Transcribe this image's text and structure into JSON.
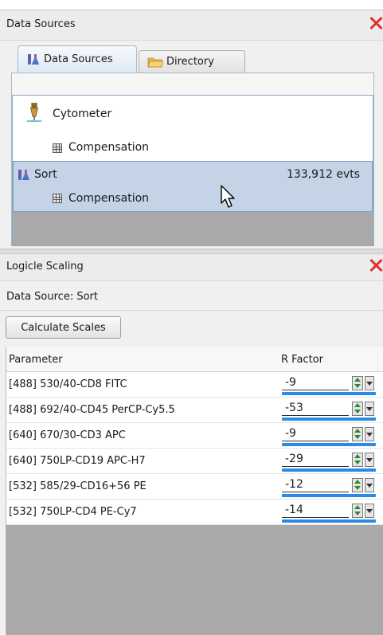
{
  "data_sources_panel": {
    "title": "Data Sources",
    "tabs": [
      {
        "label": "Data Sources",
        "icon": "flask-icon",
        "active": true
      },
      {
        "label": "Directory",
        "icon": "folder-icon",
        "active": false
      }
    ],
    "tree": {
      "cytometer": {
        "label": "Cytometer",
        "icon": "cytometer-icon"
      },
      "cytometer_comp": {
        "label": "Compensation",
        "icon": "grid-icon"
      },
      "sort": {
        "label": "Sort",
        "icon": "flask-icon",
        "count": "133,912 evts",
        "selected": true
      },
      "sort_comp": {
        "label": "Compensation",
        "icon": "grid-icon"
      }
    }
  },
  "logicle_panel": {
    "title": "Logicle Scaling",
    "data_source_label": "Data Source: Sort",
    "calculate_button": "Calculate Scales",
    "columns": {
      "parameter": "Parameter",
      "r_factor": "R Factor"
    },
    "rows": [
      {
        "parameter": "[488] 530/40-CD8 FITC",
        "r_factor": "-9"
      },
      {
        "parameter": "[488] 692/40-CD45 PerCP-Cy5.5",
        "r_factor": "-53"
      },
      {
        "parameter": "[640] 670/30-CD3 APC",
        "r_factor": "-9"
      },
      {
        "parameter": "[640] 750LP-CD19 APC-H7",
        "r_factor": "-29"
      },
      {
        "parameter": "[532] 585/29-CD16+56 PE",
        "r_factor": "-12"
      },
      {
        "parameter": "[532] 750LP-CD4 PE-Cy7",
        "r_factor": "-14"
      }
    ]
  },
  "colors": {
    "close_red": "#e0322c",
    "selection_blue": "#c5d3e6",
    "spin_bar_blue": "#2a8ae6"
  }
}
